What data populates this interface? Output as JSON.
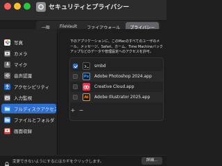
{
  "window": {
    "title": "セキュリティとプライバシー"
  },
  "tabs": [
    {
      "label": "一般",
      "active": false
    },
    {
      "label": "FileVault",
      "active": false
    },
    {
      "label": "ファイアウォール",
      "active": false
    },
    {
      "label": "プライバシー",
      "active": true
    }
  ],
  "sidebar": {
    "items": [
      {
        "label": "写真",
        "icon": "photos-icon",
        "color": "#ffffff"
      },
      {
        "label": "カメラ",
        "icon": "camera-icon",
        "color": "#6e6e73"
      },
      {
        "label": "マイク",
        "icon": "microphone-icon",
        "color": "#6e6e73"
      },
      {
        "label": "音声認識",
        "icon": "speech-recognition-icon",
        "color": "#6e6e73"
      },
      {
        "label": "アクセシビリティ",
        "icon": "accessibility-icon",
        "color": "#1f6fd8"
      },
      {
        "label": "入力監視",
        "icon": "keyboard-icon",
        "color": "#6e6e73"
      },
      {
        "label": "フルディスクアクセス",
        "icon": "folder-icon",
        "color": "#3b8ee9",
        "active": true
      },
      {
        "label": "ファイルとフォルダ",
        "icon": "folder-icon",
        "color": "#3b8ee9"
      },
      {
        "label": "画面収録",
        "icon": "screen-recording-icon",
        "color": "#e0423b"
      }
    ]
  },
  "description": "下のアプリケーションに、このMacのすべてのユーザのメール、メッセージ、Safari、ホーム、Time Machineバックアップなどのデータや管理設定へのアクセスを許可。",
  "apps": [
    {
      "name": "smbd",
      "checked": true,
      "icon": "terminal-icon",
      "icon_bg": "#1b1b1b",
      "icon_fg": "#d0d0d0",
      "glyph": ""
    },
    {
      "name": "Adobe Photoshop 2024.app",
      "checked": false,
      "icon": "photoshop-icon",
      "icon_bg": "#0b1f3a",
      "icon_fg": "#31a8ff",
      "glyph": "Ps"
    },
    {
      "name": "Creative Cloud.app",
      "checked": false,
      "icon": "creative-cloud-icon",
      "icon_bg": "#e8344f",
      "icon_fg": "#ffffff",
      "glyph": "CC"
    },
    {
      "name": "Adobe Illustrator 2025.app",
      "checked": false,
      "icon": "illustrator-icon",
      "icon_bg": "#2a1500",
      "icon_fg": "#ff9a00",
      "glyph": "Ai"
    }
  ],
  "list_controls": {
    "add": "+",
    "remove": "−"
  },
  "footer": {
    "text": "変更できないようにするにはカギをクリックします。",
    "details_button": "詳細..."
  }
}
